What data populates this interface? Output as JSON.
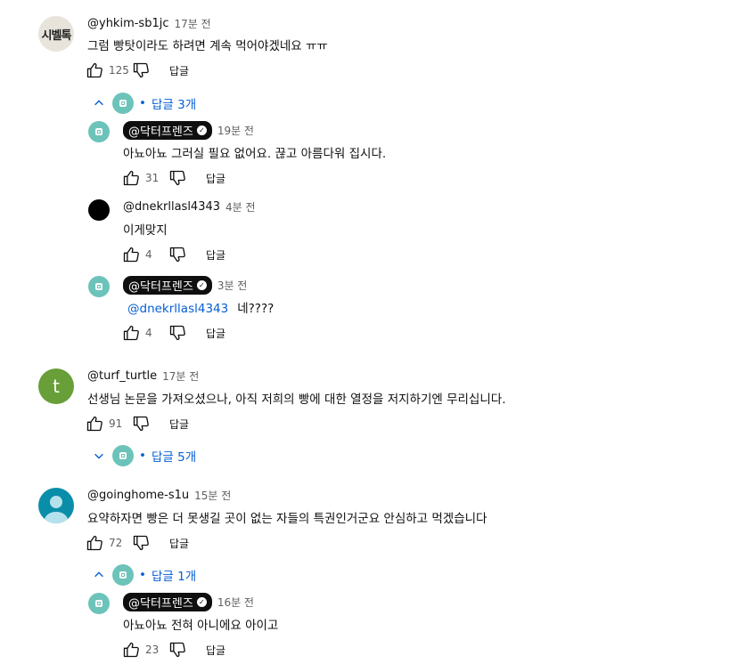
{
  "icons": {
    "like": "thumb-up-icon",
    "dislike": "thumb-down-icon",
    "collapse": "chevron-up-icon",
    "expand": "chevron-down-icon",
    "verified": "check-circle-icon"
  },
  "comments": [
    {
      "handle": "@yhkim-sb1jc",
      "time": "17분 전",
      "avatar_text": "시벨톡",
      "text": "그럼 빵탓이라도 하려면 계속 먹어야겠네요 ㅠㅠ",
      "likes": "125",
      "reply_label": "답글",
      "replies_toggle": "답글 3개"
    },
    {
      "handle": "@turf_turtle",
      "time": "17분 전",
      "avatar_text": "t",
      "text": "선생님 논문을 가져오셨으나, 아직 저희의 빵에 대한 열정을 저지하기엔 무리십니다.",
      "likes": "91",
      "reply_label": "답글",
      "replies_toggle": "답글 5개"
    },
    {
      "handle": "@goinghome-s1u",
      "time": "15분 전",
      "text": "요약하자면 빵은 더 못생길 곳이 없는 자들의 특권인거군요 안심하고 먹겠습니다",
      "likes": "72",
      "reply_label": "답글",
      "replies_toggle": "답글 1개"
    }
  ],
  "replies": [
    {
      "handle": "@닥터프렌즈",
      "time": "19분 전",
      "text": "아뇨아뇨 그러실 필요 없어요. 끊고 아름다워 집시다.",
      "likes": "31",
      "reply_label": "답글"
    },
    {
      "handle": "@dnekrllasl4343",
      "time": "4분 전",
      "text": "이게맞지",
      "likes": "4",
      "reply_label": "답글"
    },
    {
      "handle": "@닥터프렌즈",
      "time": "3분 전",
      "mention": "@dnekrllasl4343",
      "text": "네????",
      "likes": "4",
      "reply_label": "답글"
    },
    {
      "handle": "@닥터프렌즈",
      "time": "16분 전",
      "text": "아뇨아뇨 전혀 아니에요 아이고",
      "likes": "23",
      "reply_label": "답글"
    }
  ]
}
